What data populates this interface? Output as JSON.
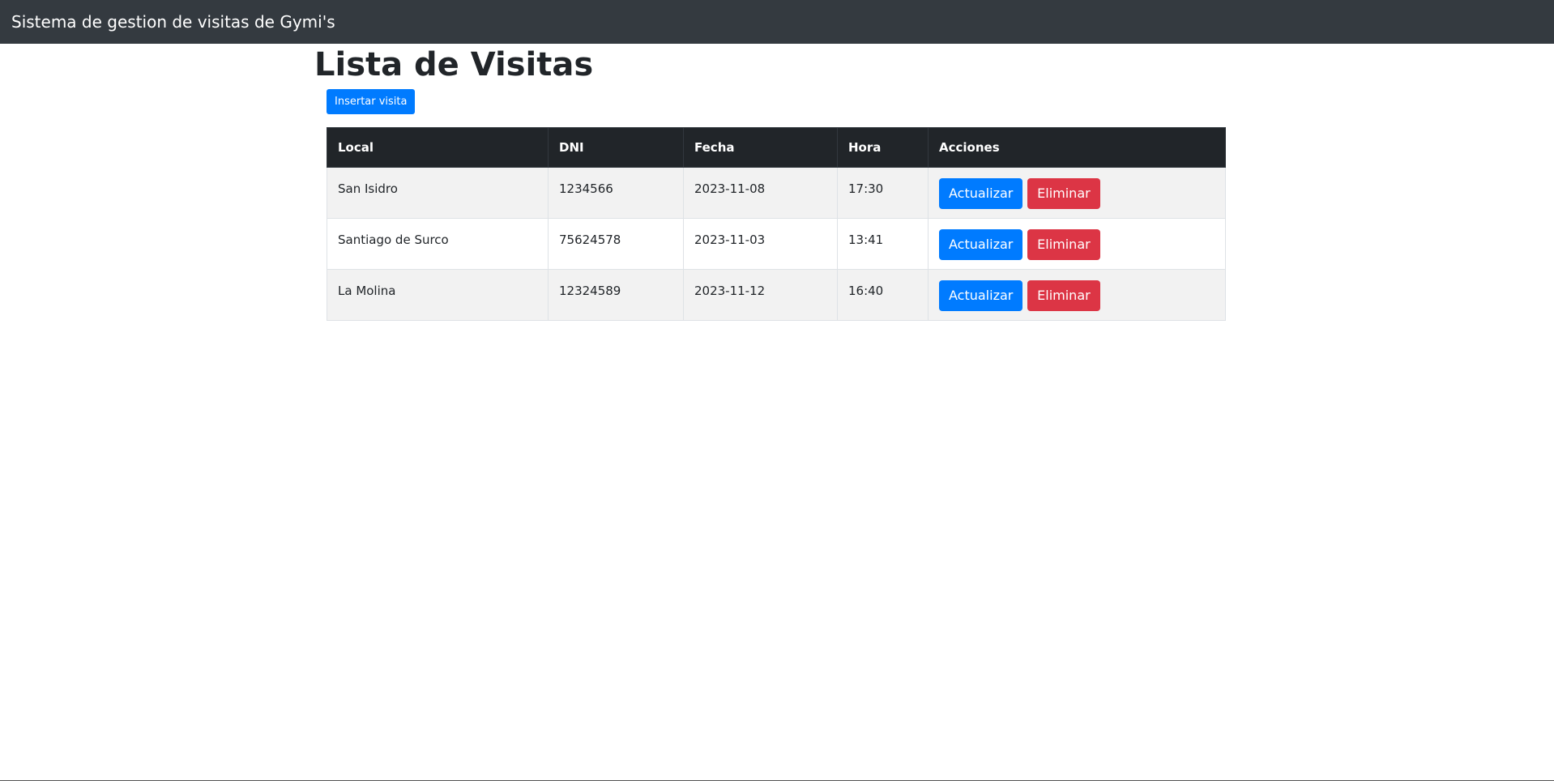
{
  "navbar": {
    "brand": "Sistema de gestion de visitas de Gymi's"
  },
  "page": {
    "title": "Lista de Visitas",
    "insert_button": "Insertar visita"
  },
  "table": {
    "headers": {
      "local": "Local",
      "dni": "DNI",
      "fecha": "Fecha",
      "hora": "Hora",
      "acciones": "Acciones"
    },
    "rows": [
      {
        "local": "San Isidro",
        "dni": "1234566",
        "fecha": "2023-11-08",
        "hora": "17:30",
        "update": "Actualizar",
        "delete": "Eliminar"
      },
      {
        "local": "Santiago de Surco",
        "dni": "75624578",
        "fecha": "2023-11-03",
        "hora": "13:41",
        "update": "Actualizar",
        "delete": "Eliminar"
      },
      {
        "local": "La Molina",
        "dni": "12324589",
        "fecha": "2023-11-12",
        "hora": "16:40",
        "update": "Actualizar",
        "delete": "Eliminar"
      }
    ]
  },
  "colors": {
    "navbar_bg": "#343a40",
    "primary": "#007bff",
    "danger": "#dc3545",
    "table_header_bg": "#212529"
  }
}
